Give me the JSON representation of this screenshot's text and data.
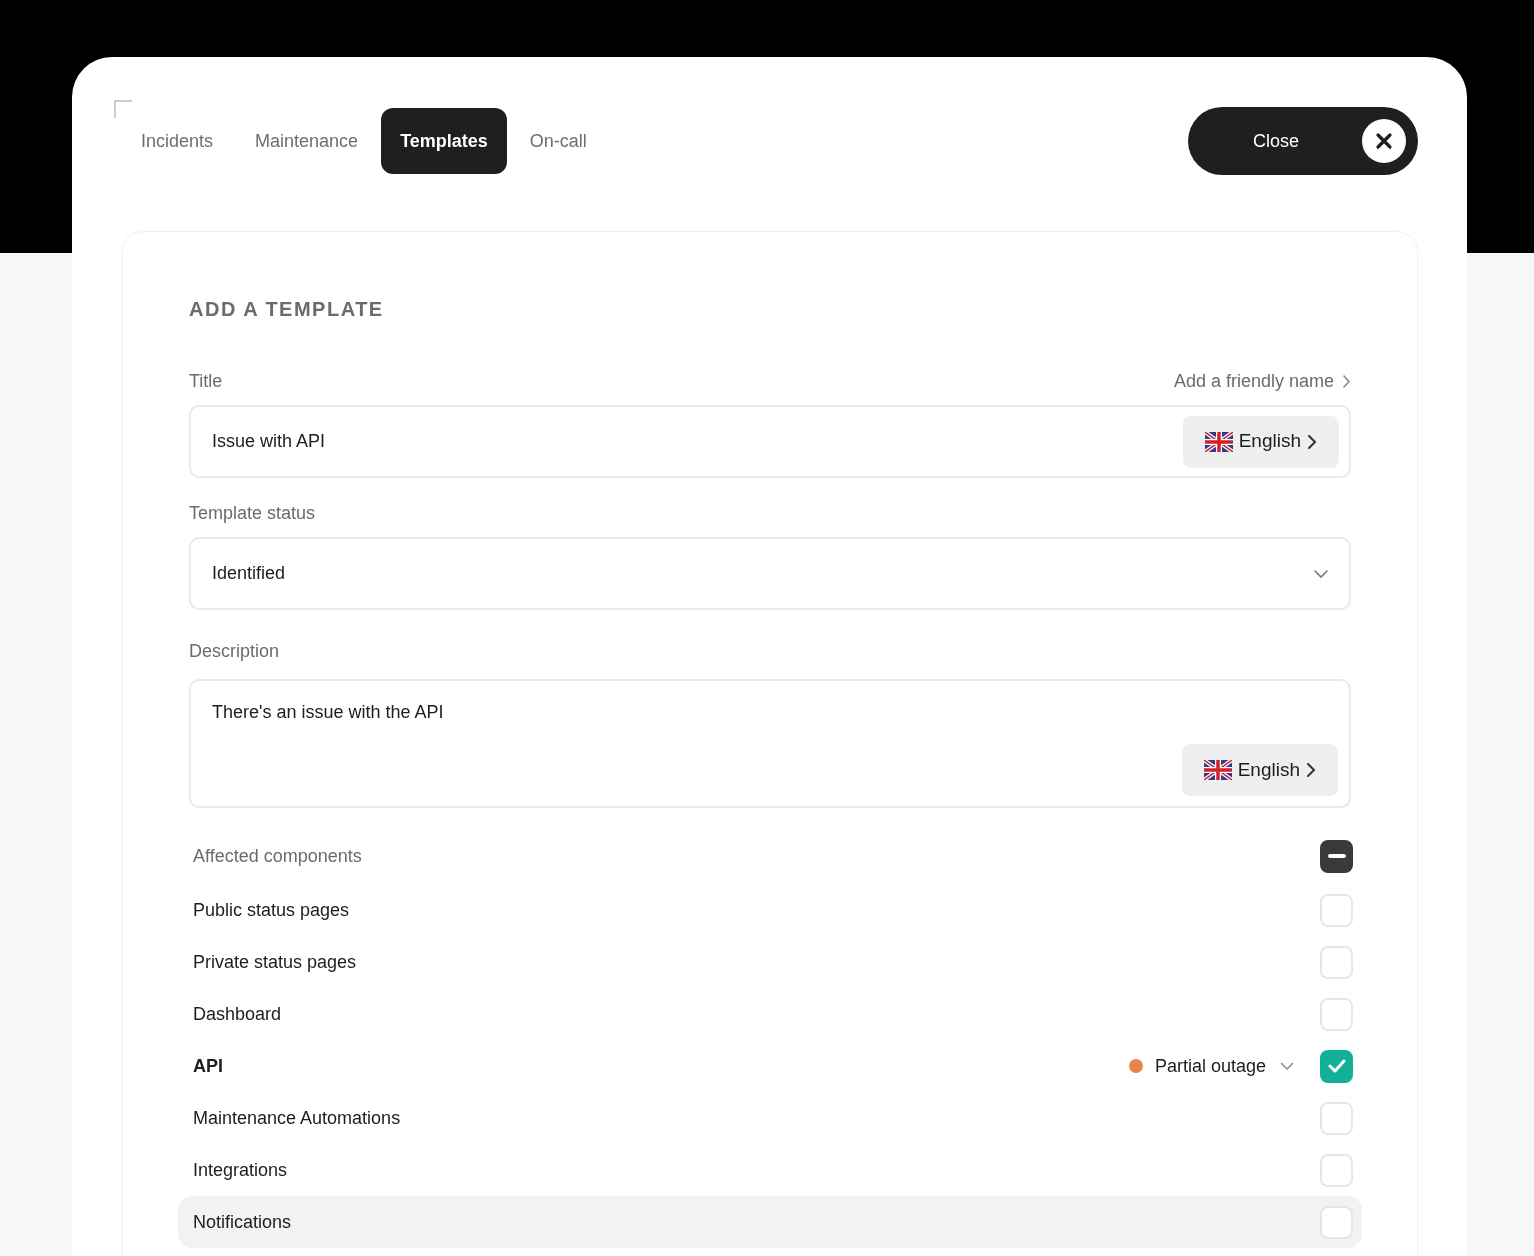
{
  "tabs": [
    {
      "label": "Incidents",
      "selected": false
    },
    {
      "label": "Maintenance",
      "selected": false
    },
    {
      "label": "Templates",
      "selected": true
    },
    {
      "label": "On-call",
      "selected": false
    }
  ],
  "close_button": {
    "label": "Close"
  },
  "form": {
    "heading": "ADD A TEMPLATE",
    "title": {
      "label": "Title",
      "link": "Add a friendly name",
      "value": "Issue with API",
      "language": "English"
    },
    "template_status": {
      "label": "Template status",
      "value": "Identified"
    },
    "description": {
      "label": "Description",
      "value": "There's an issue with the API",
      "language": "English"
    },
    "affected_components": {
      "label": "Affected components",
      "indeterminate": true,
      "items": [
        {
          "name": "Public status pages",
          "checked": false,
          "highlighted": false
        },
        {
          "name": "Private status pages",
          "checked": false,
          "highlighted": false
        },
        {
          "name": "Dashboard",
          "checked": false,
          "highlighted": false
        },
        {
          "name": "API",
          "checked": true,
          "highlighted": false,
          "status": {
            "label": "Partial outage",
            "color": "#e8834a"
          }
        },
        {
          "name": "Maintenance Automations",
          "checked": false,
          "highlighted": false
        },
        {
          "name": "Integrations",
          "checked": false,
          "highlighted": false
        },
        {
          "name": "Notifications",
          "checked": false,
          "highlighted": true
        }
      ]
    }
  }
}
